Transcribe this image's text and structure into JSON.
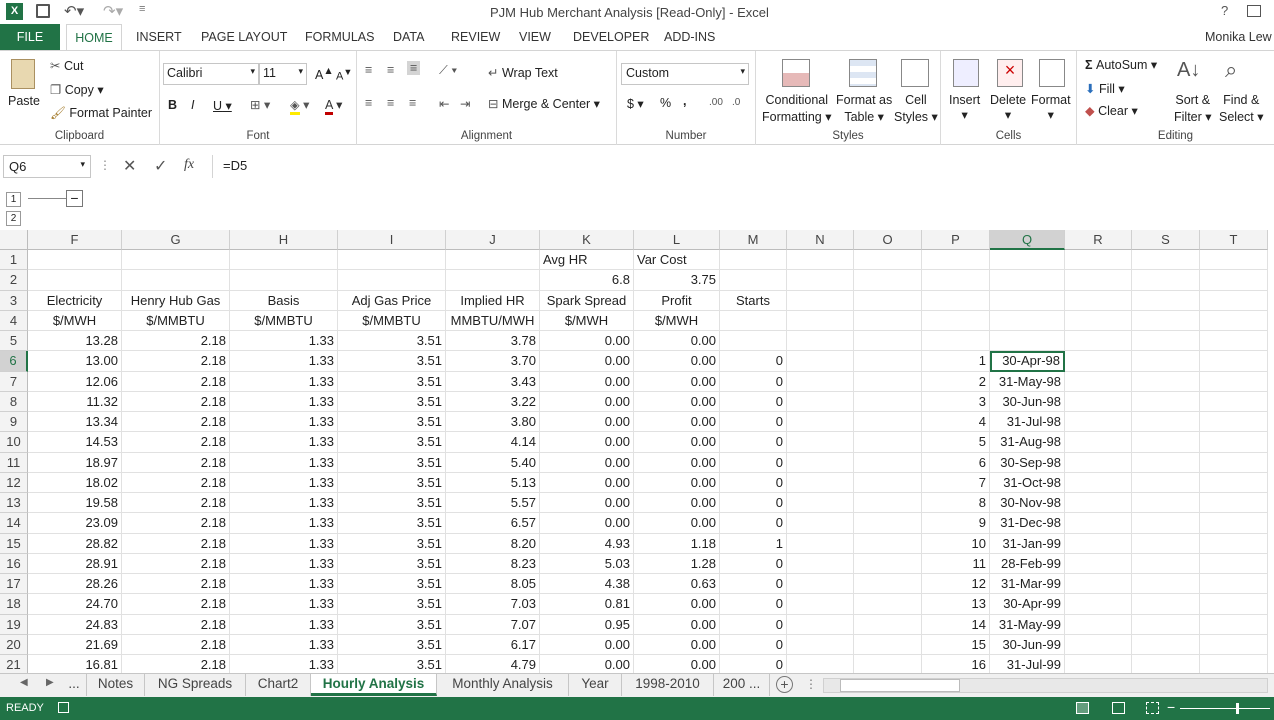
{
  "app": {
    "title": "PJM Hub Merchant Analysis  [Read-Only] - Excel",
    "user": "Monika Lew",
    "help": "?"
  },
  "ribbon_tabs": [
    "FILE",
    "HOME",
    "INSERT",
    "PAGE LAYOUT",
    "FORMULAS",
    "DATA",
    "REVIEW",
    "VIEW",
    "DEVELOPER",
    "ADD-INS"
  ],
  "clipboard": {
    "paste": "Paste",
    "cut": "Cut",
    "copy": "Copy",
    "format_painter": "Format Painter",
    "label": "Clipboard"
  },
  "font": {
    "name": "Calibri",
    "size": "11",
    "bold": "B",
    "italic": "I",
    "underline": "U",
    "label": "Font"
  },
  "alignment": {
    "wrap": "Wrap Text",
    "merge": "Merge & Center",
    "label": "Alignment"
  },
  "number": {
    "format": "Custom",
    "currency": "$",
    "percent": "%",
    "comma": ",",
    "label": "Number"
  },
  "styles": {
    "conditional": [
      "Conditional",
      "Formatting"
    ],
    "format_table": [
      "Format as",
      "Table"
    ],
    "cell_styles": [
      "Cell",
      "Styles"
    ],
    "label": "Styles"
  },
  "cells": {
    "insert": "Insert",
    "delete": "Delete",
    "format": "Format",
    "label": "Cells"
  },
  "editing": {
    "autosum": "AutoSum",
    "fill": "Fill",
    "clear": "Clear",
    "sort": [
      "Sort &",
      "Filter"
    ],
    "find": [
      "Find &",
      "Select"
    ],
    "label": "Editing"
  },
  "formula_bar": {
    "name_box": "Q6",
    "formula": "=D5",
    "fx": "fx"
  },
  "outline_levels": [
    "1",
    "2"
  ],
  "columns": [
    "F",
    "G",
    "H",
    "I",
    "J",
    "K",
    "L",
    "M",
    "N",
    "O",
    "P",
    "Q",
    "R",
    "S",
    "T"
  ],
  "rows": [
    [
      "",
      "",
      "",
      "",
      "",
      "Avg HR",
      "Var Cost",
      "",
      "",
      "",
      "",
      "",
      "",
      "",
      ""
    ],
    [
      "",
      "",
      "",
      "",
      "",
      "6.8",
      "3.75",
      "",
      "",
      "",
      "",
      "",
      "",
      "",
      ""
    ],
    [
      "Electricity",
      "Henry Hub Gas",
      "Basis",
      "Adj Gas Price",
      "Implied HR",
      "Spark Spread",
      "Profit",
      "Starts",
      "",
      "",
      "",
      "",
      "",
      "",
      ""
    ],
    [
      "$/MWH",
      "$/MMBTU",
      "$/MMBTU",
      "$/MMBTU",
      "MMBTU/MWH",
      "$/MWH",
      "$/MWH",
      "",
      "",
      "",
      "",
      "",
      "",
      "",
      ""
    ],
    [
      "13.28",
      "2.18",
      "1.33",
      "3.51",
      "3.78",
      "0.00",
      "0.00",
      "",
      "",
      "",
      "",
      "",
      "",
      "",
      ""
    ],
    [
      "13.00",
      "2.18",
      "1.33",
      "3.51",
      "3.70",
      "0.00",
      "0.00",
      "0",
      "",
      "",
      "1",
      "30-Apr-98",
      "",
      "",
      ""
    ],
    [
      "12.06",
      "2.18",
      "1.33",
      "3.51",
      "3.43",
      "0.00",
      "0.00",
      "0",
      "",
      "",
      "2",
      "31-May-98",
      "",
      "",
      ""
    ],
    [
      "11.32",
      "2.18",
      "1.33",
      "3.51",
      "3.22",
      "0.00",
      "0.00",
      "0",
      "",
      "",
      "3",
      "30-Jun-98",
      "",
      "",
      ""
    ],
    [
      "13.34",
      "2.18",
      "1.33",
      "3.51",
      "3.80",
      "0.00",
      "0.00",
      "0",
      "",
      "",
      "4",
      "31-Jul-98",
      "",
      "",
      ""
    ],
    [
      "14.53",
      "2.18",
      "1.33",
      "3.51",
      "4.14",
      "0.00",
      "0.00",
      "0",
      "",
      "",
      "5",
      "31-Aug-98",
      "",
      "",
      ""
    ],
    [
      "18.97",
      "2.18",
      "1.33",
      "3.51",
      "5.40",
      "0.00",
      "0.00",
      "0",
      "",
      "",
      "6",
      "30-Sep-98",
      "",
      "",
      ""
    ],
    [
      "18.02",
      "2.18",
      "1.33",
      "3.51",
      "5.13",
      "0.00",
      "0.00",
      "0",
      "",
      "",
      "7",
      "31-Oct-98",
      "",
      "",
      ""
    ],
    [
      "19.58",
      "2.18",
      "1.33",
      "3.51",
      "5.57",
      "0.00",
      "0.00",
      "0",
      "",
      "",
      "8",
      "30-Nov-98",
      "",
      "",
      ""
    ],
    [
      "23.09",
      "2.18",
      "1.33",
      "3.51",
      "6.57",
      "0.00",
      "0.00",
      "0",
      "",
      "",
      "9",
      "31-Dec-98",
      "",
      "",
      ""
    ],
    [
      "28.82",
      "2.18",
      "1.33",
      "3.51",
      "8.20",
      "4.93",
      "1.18",
      "1",
      "",
      "",
      "10",
      "31-Jan-99",
      "",
      "",
      ""
    ],
    [
      "28.91",
      "2.18",
      "1.33",
      "3.51",
      "8.23",
      "5.03",
      "1.28",
      "0",
      "",
      "",
      "11",
      "28-Feb-99",
      "",
      "",
      ""
    ],
    [
      "28.26",
      "2.18",
      "1.33",
      "3.51",
      "8.05",
      "4.38",
      "0.63",
      "0",
      "",
      "",
      "12",
      "31-Mar-99",
      "",
      "",
      ""
    ],
    [
      "24.70",
      "2.18",
      "1.33",
      "3.51",
      "7.03",
      "0.81",
      "0.00",
      "0",
      "",
      "",
      "13",
      "30-Apr-99",
      "",
      "",
      ""
    ],
    [
      "24.83",
      "2.18",
      "1.33",
      "3.51",
      "7.07",
      "0.95",
      "0.00",
      "0",
      "",
      "",
      "14",
      "31-May-99",
      "",
      "",
      ""
    ],
    [
      "21.69",
      "2.18",
      "1.33",
      "3.51",
      "6.17",
      "0.00",
      "0.00",
      "0",
      "",
      "",
      "15",
      "30-Jun-99",
      "",
      "",
      ""
    ],
    [
      "16.81",
      "2.18",
      "1.33",
      "3.51",
      "4.79",
      "0.00",
      "0.00",
      "0",
      "",
      "",
      "16",
      "31-Jul-99",
      "",
      "",
      ""
    ]
  ],
  "sheet_tabs": [
    "...",
    "Notes",
    "NG Spreads",
    "Chart2",
    "Hourly Analysis",
    "Monthly Analysis",
    "Year",
    "1998-2010",
    "200 ..."
  ],
  "active_sheet": "Hourly Analysis",
  "status": {
    "ready": "READY"
  },
  "colors": {
    "excel_green": "#217346",
    "selection": "#217346"
  }
}
